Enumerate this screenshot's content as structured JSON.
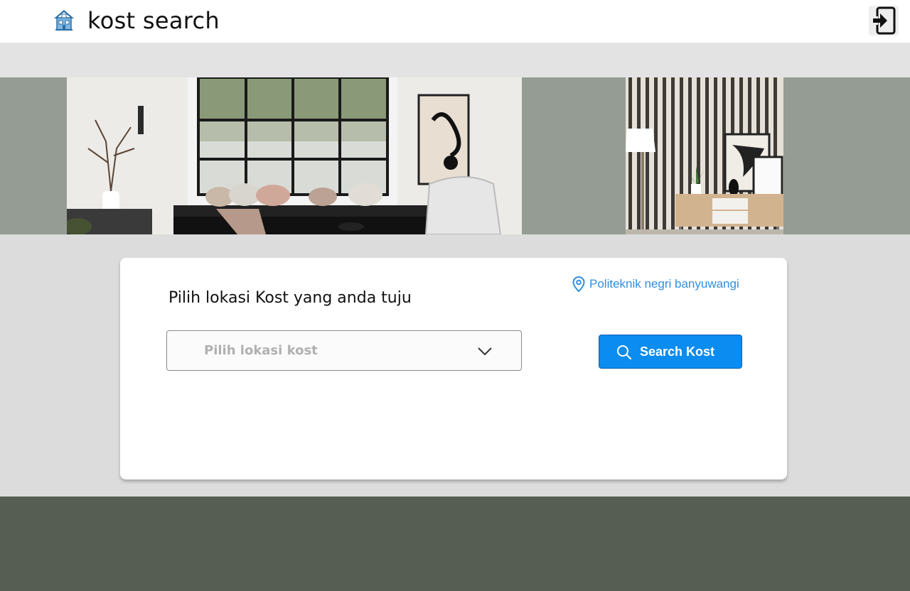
{
  "header": {
    "app_title": "kost search",
    "logo_icon": "house-icon",
    "login_icon": "sign-in-icon"
  },
  "banner": {
    "images": [
      {
        "name": "living-room-photo"
      },
      {
        "name": "striped-wall-photo"
      }
    ]
  },
  "search_card": {
    "title": "Pilih lokasi Kost yang anda tuju",
    "location_label": "Politeknik negri banyuwangi",
    "location_icon": "map-pin-icon",
    "select_placeholder": "Pilih lokasi kost",
    "search_button_label": "Search Kost",
    "search_icon": "search-icon"
  },
  "colors": {
    "accent": "#0a8cf0",
    "link": "#2f8fe0",
    "footer": "#565e53",
    "banner_bg": "#959c94"
  }
}
